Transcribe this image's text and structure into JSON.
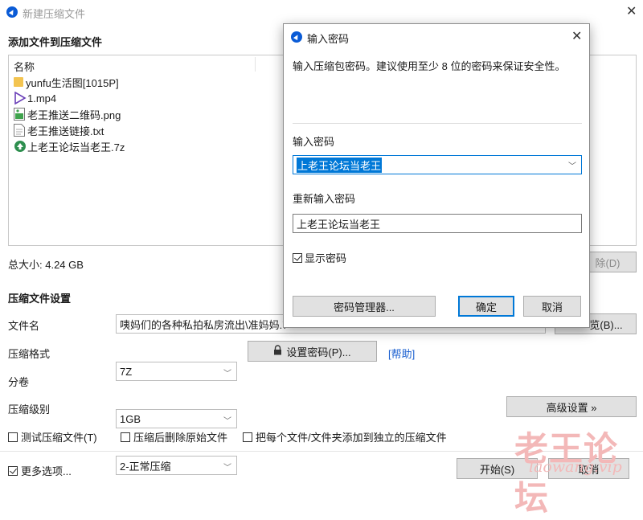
{
  "window": {
    "title": "新建压缩文件"
  },
  "files_section": {
    "title": "添加文件到压缩文件",
    "column_name": "名称",
    "items": [
      {
        "name": "yunfu生活图[1015P]",
        "icon": "folder-icon"
      },
      {
        "name": "1.mp4",
        "icon": "video-file-icon"
      },
      {
        "name": "老王推送二维码.png",
        "icon": "image-file-icon"
      },
      {
        "name": "老王推送链接.txt",
        "icon": "text-file-icon"
      },
      {
        "name": "上老王论坛当老王.7z",
        "icon": "archive-file-icon"
      }
    ],
    "total_size": "总大小: 4.24 GB",
    "delete_button": "除(D)"
  },
  "settings": {
    "title": "压缩文件设置",
    "filename_label": "文件名",
    "filename_value": "咦妈们的各种私拍私房流出\\准妈妈.7",
    "browse_button": "览(B)...",
    "format_label": "压缩格式",
    "format_value": "7Z",
    "set_password_button": "设置密码(P)...",
    "help_link": "[帮助]",
    "split_label": "分卷",
    "split_value": "1GB",
    "level_label": "压缩级别",
    "level_value": "2-正常压缩",
    "advanced_button": "高级设置 »",
    "test_archive": {
      "label": "测试压缩文件(T)",
      "checked": false
    },
    "delete_after": {
      "label": "压缩后删除原始文件",
      "checked": false
    },
    "separate_archives": {
      "label": "把每个文件/文件夹添加到独立的压缩文件",
      "checked": false
    },
    "more_options": {
      "label": "更多选项...",
      "checked": true
    },
    "start_button": "开始(S)",
    "cancel_button": "取消"
  },
  "password_dialog": {
    "title": "输入密码",
    "hint": "输入压缩包密码。建议使用至少 8 位的密码来保证安全性。",
    "password_label": "输入密码",
    "password_value": "上老王论坛当老王",
    "reenter_label": "重新输入密码",
    "reenter_value": "上老王论坛当老王",
    "show_password": {
      "label": "显示密码",
      "checked": true
    },
    "manager_button": "密码管理器...",
    "ok_button": "确定",
    "cancel_button": "取消"
  },
  "watermark": {
    "text": "老王论坛",
    "subtext": "laowang.vip"
  },
  "colors": {
    "accent": "#0078d7",
    "link": "#1a5fd0",
    "folder": "#f3c450",
    "watermark": "#f3b8b8"
  }
}
